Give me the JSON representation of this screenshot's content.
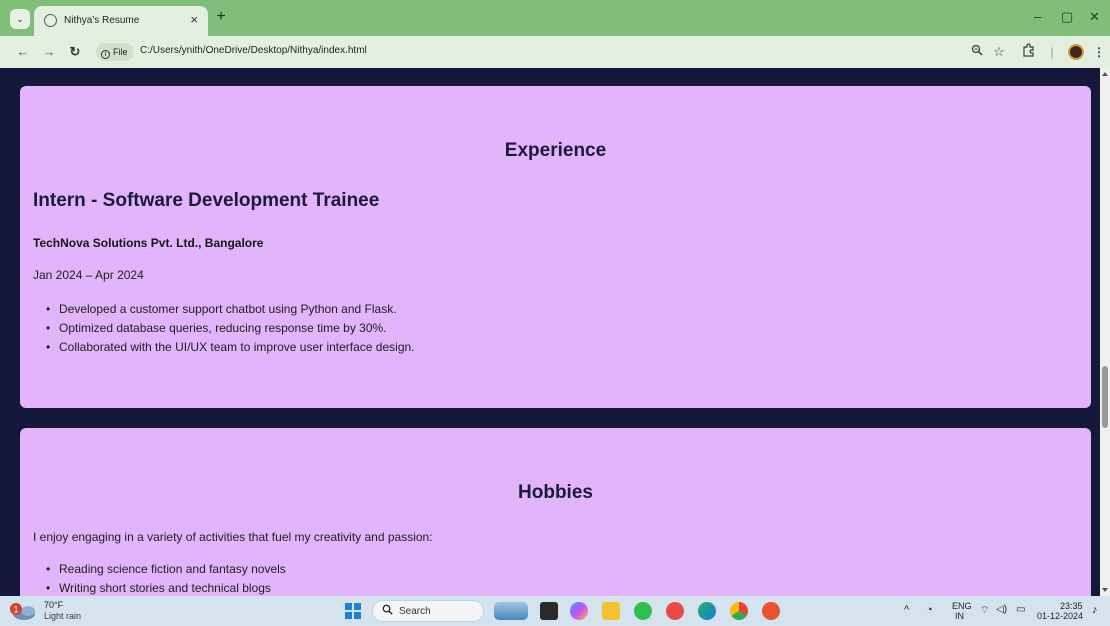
{
  "browser": {
    "tab_title": "Nithya's Resume",
    "tab_close": "×",
    "new_tab": "+",
    "file_chip": "File",
    "url": "C:/Users/ynith/OneDrive/Desktop/Nithya/index.html",
    "window_controls": {
      "minimize": "–",
      "restore": "▢",
      "close": "✕"
    }
  },
  "experience": {
    "heading": "Experience",
    "job_title": "Intern - Software Development Trainee",
    "company": "TechNova Solutions Pvt. Ltd., Bangalore",
    "dates": "Jan 2024 – Apr 2024",
    "bullets": [
      "Developed a customer support chatbot using Python and Flask.",
      "Optimized database queries, reducing response time by 30%.",
      "Collaborated with the UI/UX team to improve user interface design."
    ]
  },
  "hobbies": {
    "heading": "Hobbies",
    "intro": "I enjoy engaging in a variety of activities that fuel my creativity and passion:",
    "items": [
      "Reading science fiction and fantasy novels",
      "Writing short stories and technical blogs"
    ]
  },
  "taskbar": {
    "weather_badge": "1",
    "temperature": "70°F",
    "weather": "Light rain",
    "search_label": "Search",
    "lang_line1": "ENG",
    "lang_line2": "IN",
    "time": "23:35",
    "date": "01-12-2024"
  },
  "colors": {
    "page_background": "#15183a",
    "card_background": "#e2b4fb",
    "tab_strip": "#7fbf7a"
  }
}
